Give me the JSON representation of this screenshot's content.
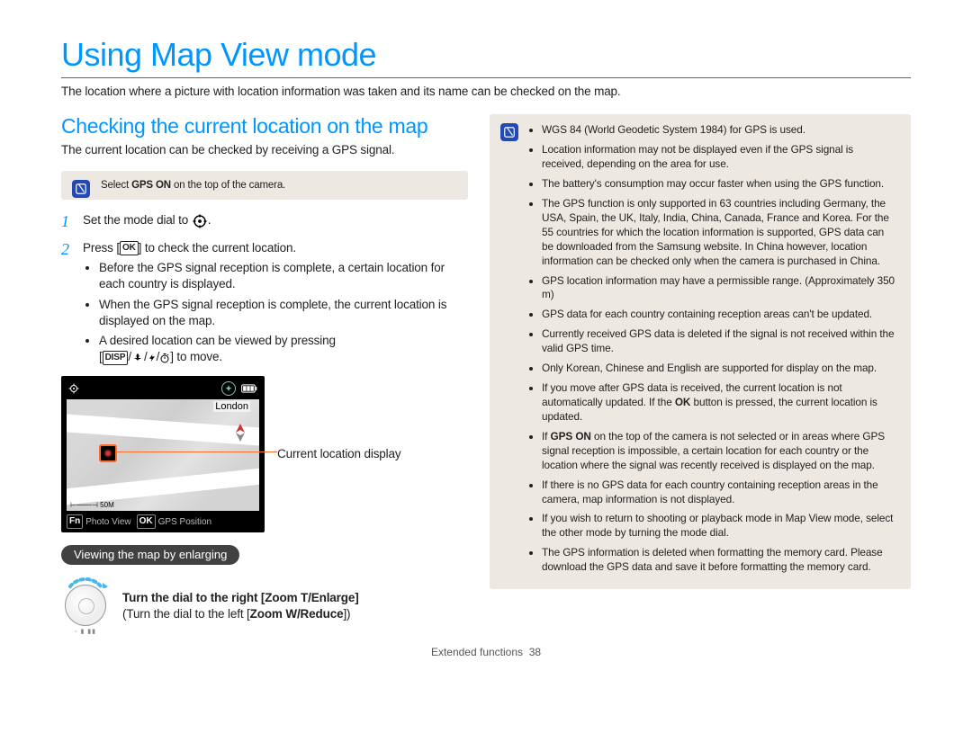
{
  "title": "Using Map View mode",
  "intro": "The location where a picture with location information was taken and its name can be checked on the map.",
  "left": {
    "heading": "Checking the current location on the map",
    "lead": "The current location can be checked by receiving a GPS signal.",
    "note_prefix": "Select ",
    "note_bold": "GPS ON",
    "note_suffix": " on the top of the camera.",
    "step1_num": "1",
    "step1_text": "Set the mode dial to ",
    "step2_num": "2",
    "step2_pre": "Press [",
    "step2_key": "OK",
    "step2_post": "] to check the current location.",
    "step2_b1": "Before the GPS signal reception is complete, a certain location for each country is displayed.",
    "step2_b2": "When the GPS signal reception is complete, the current location is displayed on the map.",
    "step2_b3a": "A desired location can be viewed by pressing",
    "step2_b3b_pre": "[",
    "step2_b3b_key": "DISP",
    "step2_b3b_mid": "/",
    "step2_b3b_post": "] to move.",
    "map": {
      "city": "London",
      "scale": "50M",
      "left_btn": "Photo View",
      "left_key": "Fn",
      "right_btn": "GPS Position",
      "right_key": "OK"
    },
    "callout": "Current location display",
    "pill": "Viewing the map by enlarging",
    "dial_line1_pre": "Turn the dial to the right [",
    "dial_line1_bold": "Zoom T/Enlarge",
    "dial_line1_post": "]",
    "dial_line2_pre": "(Turn the dial to the left [",
    "dial_line2_bold": "Zoom W/Reduce",
    "dial_line2_post": "])"
  },
  "right_notes": [
    "WGS 84 (World Geodetic System 1984) for GPS is used.",
    "Location information may not be displayed even if the GPS signal is received, depending on the area for use.",
    "The battery's consumption may occur faster when using the GPS function.",
    "The GPS function is only supported in 63 countries including Germany, the USA, Spain, the UK, Italy, India, China, Canada, France and Korea. For the 55 countries for which the location information is supported, GPS data can be downloaded from the Samsung website. In China however, location information can be checked only when the camera is purchased in China.",
    "GPS location information may have a permissible range. (Approximately 350 m)",
    "GPS data for each country containing reception areas can't be updated.",
    "Currently received GPS data is deleted if the signal is not received within the valid GPS time.",
    "Only Korean, Chinese and English are supported for display on the map.",
    "If you move after GPS data is received, the current location is not automatically updated. If the OK button is pressed, the current location is updated.",
    "If GPS ON on the top of the camera is not selected or in areas where GPS signal reception is impossible, a certain location for each country or the location where the signal was recently received is displayed on the map.",
    "If there is no GPS data for each country containing reception areas in the camera, map information is not displayed.",
    "If you wish to return to shooting or playback mode in Map View mode, select the other mode by turning the mode dial.",
    "The GPS information is deleted when formatting the memory card. Please download the GPS data and save it before formatting the memory card."
  ],
  "footer_section": "Extended functions",
  "footer_page": "38"
}
